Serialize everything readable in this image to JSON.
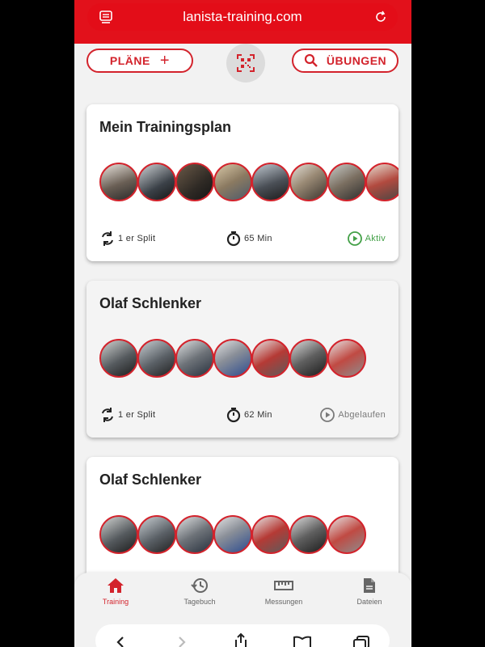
{
  "browser": {
    "url": "lanista-training.com"
  },
  "toolbar": {
    "plans_label": "PLÄNE",
    "exercises_label": "ÜBUNGEN"
  },
  "cards": [
    {
      "title": "Mein Trainingsplan",
      "split": "1 er Split",
      "duration": "65 Min",
      "status": "Aktiv"
    },
    {
      "title": "Olaf Schlenker",
      "split": "1 er Split",
      "duration": "62 Min",
      "status": "Abgelaufen"
    },
    {
      "title": "Olaf Schlenker"
    }
  ],
  "nav": [
    {
      "label": "Training",
      "icon": "home-icon",
      "active": true
    },
    {
      "label": "Tagebuch",
      "icon": "history-icon",
      "active": false
    },
    {
      "label": "Messungen",
      "icon": "ruler-icon",
      "active": false
    },
    {
      "label": "Dateien",
      "icon": "file-icon",
      "active": false
    }
  ],
  "colors": {
    "brand_red": "#d3232c",
    "active_green": "#43a047",
    "expired_gray": "#7a7a7a"
  },
  "icons": {
    "qr": "qr-code-icon",
    "search": "search-icon",
    "plus": "plus-icon"
  }
}
